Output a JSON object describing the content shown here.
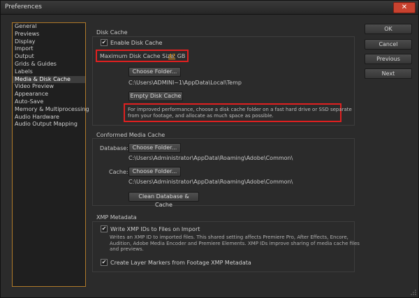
{
  "window": {
    "title": "Preferences",
    "close_glyph": "✕"
  },
  "nav": {
    "items": [
      {
        "label": "General",
        "selected": false
      },
      {
        "label": "Previews",
        "selected": false
      },
      {
        "label": "Display",
        "selected": false
      },
      {
        "label": "Import",
        "selected": false
      },
      {
        "label": "Output",
        "selected": false
      },
      {
        "label": "Grids & Guides",
        "selected": false
      },
      {
        "label": "Labels",
        "selected": false
      },
      {
        "label": "Media & Disk Cache",
        "selected": true
      },
      {
        "label": "Video Preview",
        "selected": false
      },
      {
        "label": "Appearance",
        "selected": false
      },
      {
        "label": "Auto-Save",
        "selected": false
      },
      {
        "label": "Memory & Multiprocessing",
        "selected": false
      },
      {
        "label": "Audio Hardware",
        "selected": false
      },
      {
        "label": "Audio Output Mapping",
        "selected": false
      }
    ]
  },
  "disk_cache": {
    "header": "Disk Cache",
    "enable_label": "Enable Disk Cache",
    "enable_checked": true,
    "max_size_label": "Maximum Disk Cache Size:",
    "max_size_value": "47",
    "max_size_unit": "GB",
    "choose_folder": "Choose Folder...",
    "path": "C:\\Users\\ADMINI~1\\AppData\\Local\\Temp",
    "empty_button": "Empty Disk Cache",
    "info_line1": "For improved performance, choose a disk cache folder on a fast hard drive or SSD separate",
    "info_line2": "from your footage, and allocate as much space as possible."
  },
  "conformed": {
    "header": "Conformed Media Cache",
    "database_label": "Database:",
    "database_button": "Choose Folder...",
    "database_path": "C:\\Users\\Administrator\\AppData\\Roaming\\Adobe\\Common\\",
    "cache_label": "Cache:",
    "cache_button": "Choose Folder...",
    "cache_path": "C:\\Users\\Administrator\\AppData\\Roaming\\Adobe\\Common\\",
    "clean_button": "Clean Database & Cache"
  },
  "xmp": {
    "header": "XMP Metadata",
    "write_label": "Write XMP IDs to Files on Import",
    "write_checked": true,
    "desc_line1": "Writes an XMP ID to imported files. This shared setting affects Premiere Pro, After Effects, Encore,",
    "desc_line2": "Audition, Adobe Media Encoder and Premiere Elements. XMP IDs improve sharing of media cache files",
    "desc_line3": "and previews.",
    "markers_label": "Create Layer Markers from Footage XMP Metadata",
    "markers_checked": true
  },
  "buttons": {
    "ok": "OK",
    "cancel": "Cancel",
    "previous": "Previous",
    "next": "Next"
  },
  "check_glyph": "✔"
}
